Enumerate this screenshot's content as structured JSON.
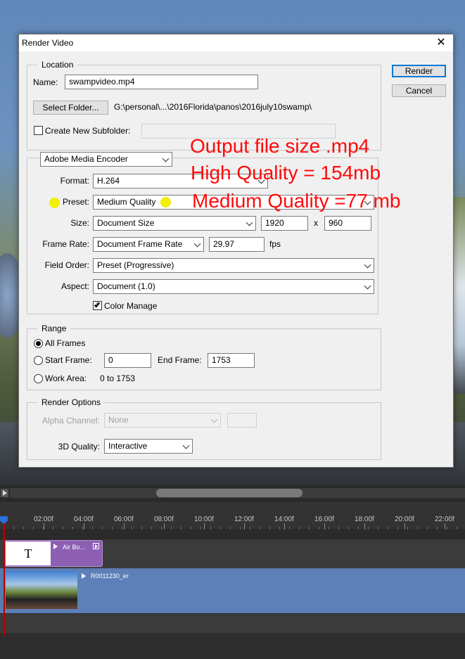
{
  "dialog": {
    "title": "Render Video",
    "close_glyph": "✕",
    "render_label": "Render",
    "cancel_label": "Cancel"
  },
  "location": {
    "legend": "Location",
    "name_label": "Name:",
    "name_value": "swampvideo.mp4",
    "select_folder_label": "Select Folder...",
    "folder_path": "G:\\personal\\...\\2016Florida\\panos\\2016july10swamp\\",
    "create_subfolder_label": "Create New Subfolder:",
    "create_subfolder_checked": false,
    "subfolder_value": ""
  },
  "encoder": {
    "encoder_value": "Adobe Media Encoder",
    "format_label": "Format:",
    "format_value": "H.264",
    "preset_label": "Preset:",
    "preset_value": "Medium Quality",
    "size_label": "Size:",
    "size_value": "Document Size",
    "width_value": "1920",
    "x_label": "x",
    "height_value": "960",
    "frame_rate_label": "Frame Rate:",
    "frame_rate_value": "Document Frame Rate",
    "fps_value": "29.97",
    "fps_label": "fps",
    "field_order_label": "Field Order:",
    "field_order_value": "Preset (Progressive)",
    "aspect_label": "Aspect:",
    "aspect_value": "Document (1.0)",
    "color_manage_label": "Color Manage",
    "color_manage_checked": true
  },
  "range": {
    "legend": "Range",
    "all_frames_label": "All Frames",
    "start_frame_label": "Start Frame:",
    "start_frame_value": "0",
    "end_frame_label": "End Frame:",
    "end_frame_value": "1753",
    "work_area_label": "Work Area:",
    "work_area_value": "0 to 1753",
    "selected": "all_frames"
  },
  "render_options": {
    "legend": "Render Options",
    "alpha_channel_label": "Alpha Channel:",
    "alpha_channel_value": "None",
    "quality_3d_label": "3D Quality:",
    "quality_3d_value": "Interactive"
  },
  "annotation": {
    "line1": "Output file size .mp4",
    "line2": "High Quality = 154mb",
    "line3": "Medium Quality =77 mb",
    "color": "#ff0a0a",
    "marker_color": "#f0f000"
  },
  "timeline": {
    "ticks": [
      "02:00f",
      "04:00f",
      "06:00f",
      "08:00f",
      "10:00f",
      "12:00f",
      "14:00f",
      "16:00f",
      "18:00f",
      "20:00f",
      "22:00f"
    ],
    "title_clip_glyph": "T",
    "title_clip_name": "Air Bo...",
    "video_clip_name": "R0011230_er",
    "title_clip_color": "#8c5fb3",
    "video_track_color": "#5a7bb0"
  }
}
